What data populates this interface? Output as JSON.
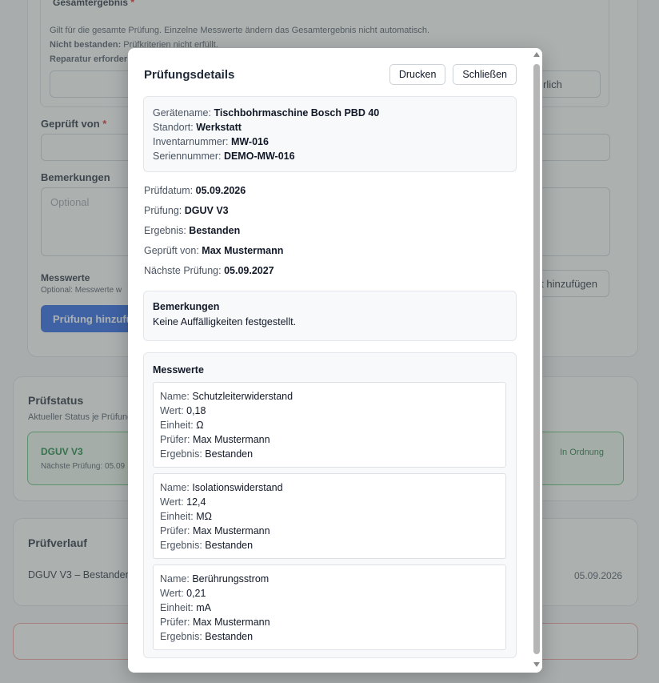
{
  "background": {
    "ergebnis_label": "Gesamtergebnis",
    "ergebnis_hint": "Gilt für die gesamte Prüfung. Einzelne Messwerte ändern das Gesamtergebnis nicht automatisch.",
    "nicht_bestanden_key": "Nicht bestanden:",
    "nicht_bestanden_value": "Prüfkriterien nicht erfüllt.",
    "reparatur_key": "Reparatur erforderlich",
    "btn_left_partial": "Be",
    "btn_right_partial": "rlich",
    "geprueft_label": "Geprüft von",
    "bemerkungen_label": "Bemerkungen",
    "bemerkungen_placeholder": "Optional",
    "messwerte_label": "Messwerte",
    "messwerte_hint_partial": "Optional: Messwerte w",
    "add_messwert_partial": "t hinzufügen",
    "add_pruefung_partial": "Prüfung hinzufüge",
    "pruefstatus_title": "Prüfstatus",
    "pruefstatus_hint_partial": "Aktueller Status je Prüfung",
    "status_name": "DGUV V3",
    "status_next_partial": "Nächste Prüfung: 05.09",
    "status_badge": "In Ordnung",
    "verlauf_title": "Prüfverlauf",
    "verlauf_item_partial": "DGUV V3 – Bestanden",
    "verlauf_date": "05.09.2026"
  },
  "modal": {
    "title": "Prüfungsdetails",
    "print_button": "Drucken",
    "close_button": "Schließen",
    "device": {
      "name_label": "Gerätename:",
      "name": "Tischbohrmaschine Bosch PBD 40",
      "location_label": "Standort:",
      "location": "Werkstatt",
      "inventory_label": "Inventarnummer:",
      "inventory": "MW-016",
      "serial_label": "Seriennummer:",
      "serial": "DEMO-MW-016"
    },
    "details": {
      "date_label": "Prüfdatum:",
      "date": "05.09.2026",
      "type_label": "Prüfung:",
      "type": "DGUV V3",
      "result_label": "Ergebnis:",
      "result": "Bestanden",
      "inspector_label": "Geprüft von:",
      "inspector": "Max Mustermann",
      "next_label": "Nächste Prüfung:",
      "next": "05.09.2027"
    },
    "remarks": {
      "title": "Bemerkungen",
      "text": "Keine Auffälligkeiten festgestellt."
    },
    "measurements": {
      "title": "Messwerte",
      "labels": {
        "name": "Name:",
        "value": "Wert:",
        "unit": "Einheit:",
        "tester": "Prüfer:",
        "result": "Ergebnis:"
      },
      "items": [
        {
          "name": "Schutzleiterwiderstand",
          "value": "0,18",
          "unit": "Ω",
          "tester": "Max Mustermann",
          "result": "Bestanden"
        },
        {
          "name": "Isolationswiderstand",
          "value": "12,4",
          "unit": "MΩ",
          "tester": "Max Mustermann",
          "result": "Bestanden"
        },
        {
          "name": "Berührungsstrom",
          "value": "0,21",
          "unit": "mA",
          "tester": "Max Mustermann",
          "result": "Bestanden"
        }
      ]
    }
  },
  "colors": {
    "overlay": "#5a6260",
    "status_green": "#16a34a",
    "primary_button": "#2563eb",
    "required": "#dc2626"
  }
}
